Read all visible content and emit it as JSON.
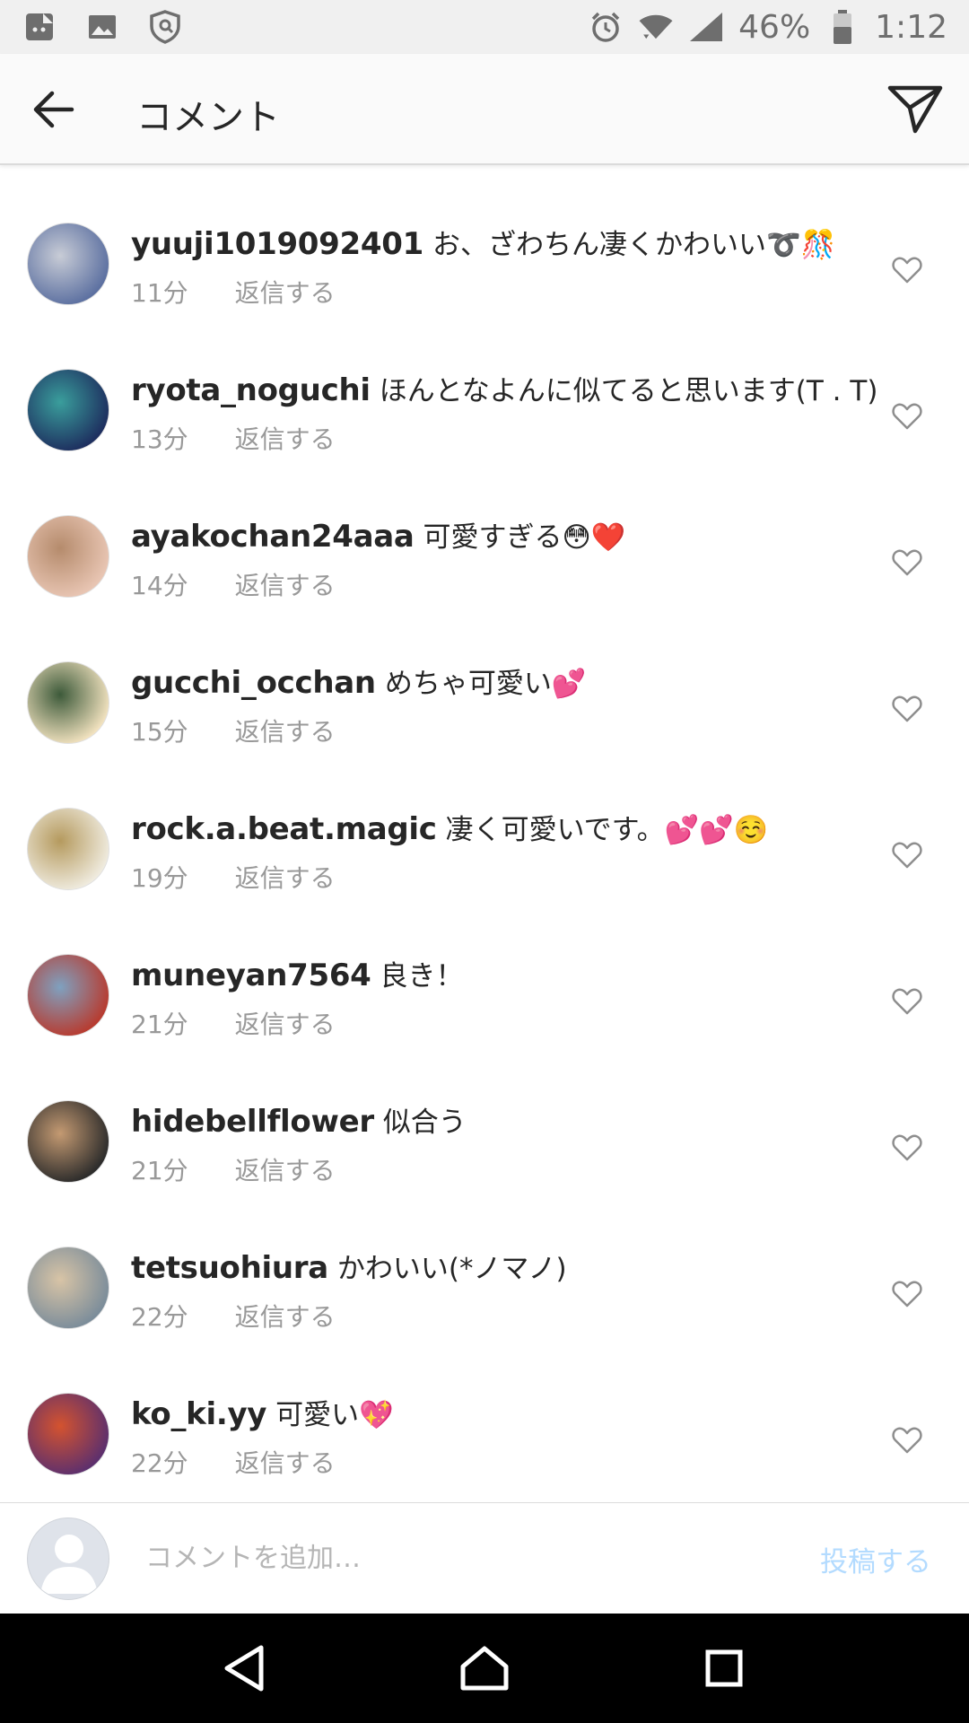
{
  "status_bar": {
    "battery": "46%",
    "time": "1:12",
    "left_icons": [
      "app-notification-icon",
      "image-icon",
      "shield-icon"
    ],
    "right_icons": [
      "alarm-icon",
      "wifi-icon",
      "signal-icon",
      "battery-icon"
    ]
  },
  "header": {
    "title": "コメント",
    "back_icon": "back-arrow-icon",
    "send_icon": "send-icon"
  },
  "comments": [
    {
      "username": "yuuji1019092401",
      "text": "お、ざわちん凄くかわいい➰🎊",
      "time": "11分",
      "reply": "返信する",
      "avatar_colors": [
        "#5b6fa0",
        "#c8ccd6"
      ]
    },
    {
      "username": "ryota_noguchi",
      "text": "ほんとなよんに似てると思います(T . T)",
      "time": "13分",
      "reply": "返信する",
      "avatar_colors": [
        "#1d2d5e",
        "#3a9e9c"
      ]
    },
    {
      "username": "ayakochan24aaa",
      "text": "可愛すぎる😳❤️",
      "time": "14分",
      "reply": "返信する",
      "avatar_colors": [
        "#e9c6b4",
        "#b58b6c"
      ]
    },
    {
      "username": "gucchi_occhan",
      "text": "めちゃ可愛い💕",
      "time": "15分",
      "reply": "返信する",
      "avatar_colors": [
        "#f3e3c0",
        "#3d5a3a"
      ]
    },
    {
      "username": "rock.a.beat.magic",
      "text": "凄く可愛いです。💕💕☺️",
      "time": "19分",
      "reply": "返信する",
      "avatar_colors": [
        "#f0ece0",
        "#b59a5e"
      ]
    },
    {
      "username": "muneyan7564",
      "text": "良き！",
      "time": "21分",
      "reply": "返信する",
      "avatar_colors": [
        "#b83a2e",
        "#7fa1c0"
      ]
    },
    {
      "username": "hidebellflower",
      "text": "似合う",
      "time": "21分",
      "reply": "返信する",
      "avatar_colors": [
        "#2a2a2a",
        "#c49a72"
      ]
    },
    {
      "username": "tetsuohiura",
      "text": "かわいい(*ノマノ)",
      "time": "22分",
      "reply": "返信する",
      "avatar_colors": [
        "#7a8c9a",
        "#d8c4a6"
      ]
    },
    {
      "username": "ko_ki.yy",
      "text": "可愛い💖",
      "time": "22分",
      "reply": "返信する",
      "avatar_colors": [
        "#5b2f6e",
        "#d4532f"
      ]
    }
  ],
  "input_bar": {
    "placeholder": "コメントを追加…",
    "post_label": "投稿する"
  },
  "nav_bar": {
    "icons": [
      "nav-back-icon",
      "nav-home-icon",
      "nav-recents-icon"
    ]
  },
  "colors": {
    "header_bg": "#fafafa",
    "secondary_text": "#999999",
    "post_button": "#b3dbff",
    "nav_bg": "#000000"
  }
}
